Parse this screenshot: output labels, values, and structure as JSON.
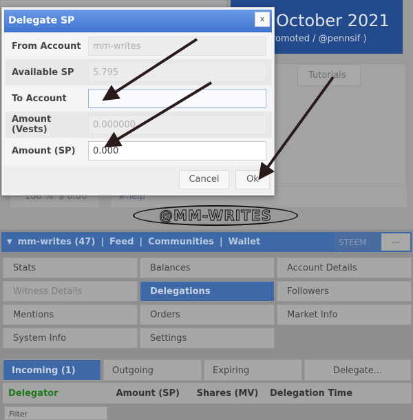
{
  "background": {
    "banner_title": "October 2021",
    "banner_subtitle": "romoted / @pennsif )",
    "tab_tutorials": "Tutorials",
    "percent": "100 %",
    "amount": "$ 0.00",
    "tag": "#help",
    "watermark": "@MM-WRITES"
  },
  "modal": {
    "title": "Delegate SP",
    "close_label": "x",
    "fields": [
      {
        "label": "From Account",
        "value": "mm-writes"
      },
      {
        "label": "Available SP",
        "value": "5.795"
      },
      {
        "label": "To Account",
        "value": ""
      },
      {
        "label": "Amount (Vests)",
        "value": "0.000000"
      },
      {
        "label": "Amount (SP)",
        "value": "0.000"
      }
    ],
    "cancel_label": "Cancel",
    "ok_label": "Ok"
  },
  "navbar": {
    "account": "mm-writes (47)",
    "sep": "|",
    "feed": "Feed",
    "communities": "Communities",
    "wallet": "Wallet",
    "currency": "STEEM",
    "more": "..."
  },
  "menu": [
    "Stats",
    "Balances",
    "Account Details",
    "Witness Details",
    "Delegations",
    "Followers",
    "Mentions",
    "Orders",
    "Market Info",
    "System Info",
    "Settings"
  ],
  "tabs": [
    "Incoming (1)",
    "Outgoing",
    "Expiring",
    "Delegate..."
  ],
  "table": {
    "headers": [
      "Delegator",
      "Amount (SP)",
      "Shares (MV)",
      "Delegation Time"
    ],
    "filter": "Filter"
  },
  "colors": {
    "accent": "#3f74cf",
    "delegator_header": "#1e9a1e",
    "arrow": "#2a1a1a"
  }
}
